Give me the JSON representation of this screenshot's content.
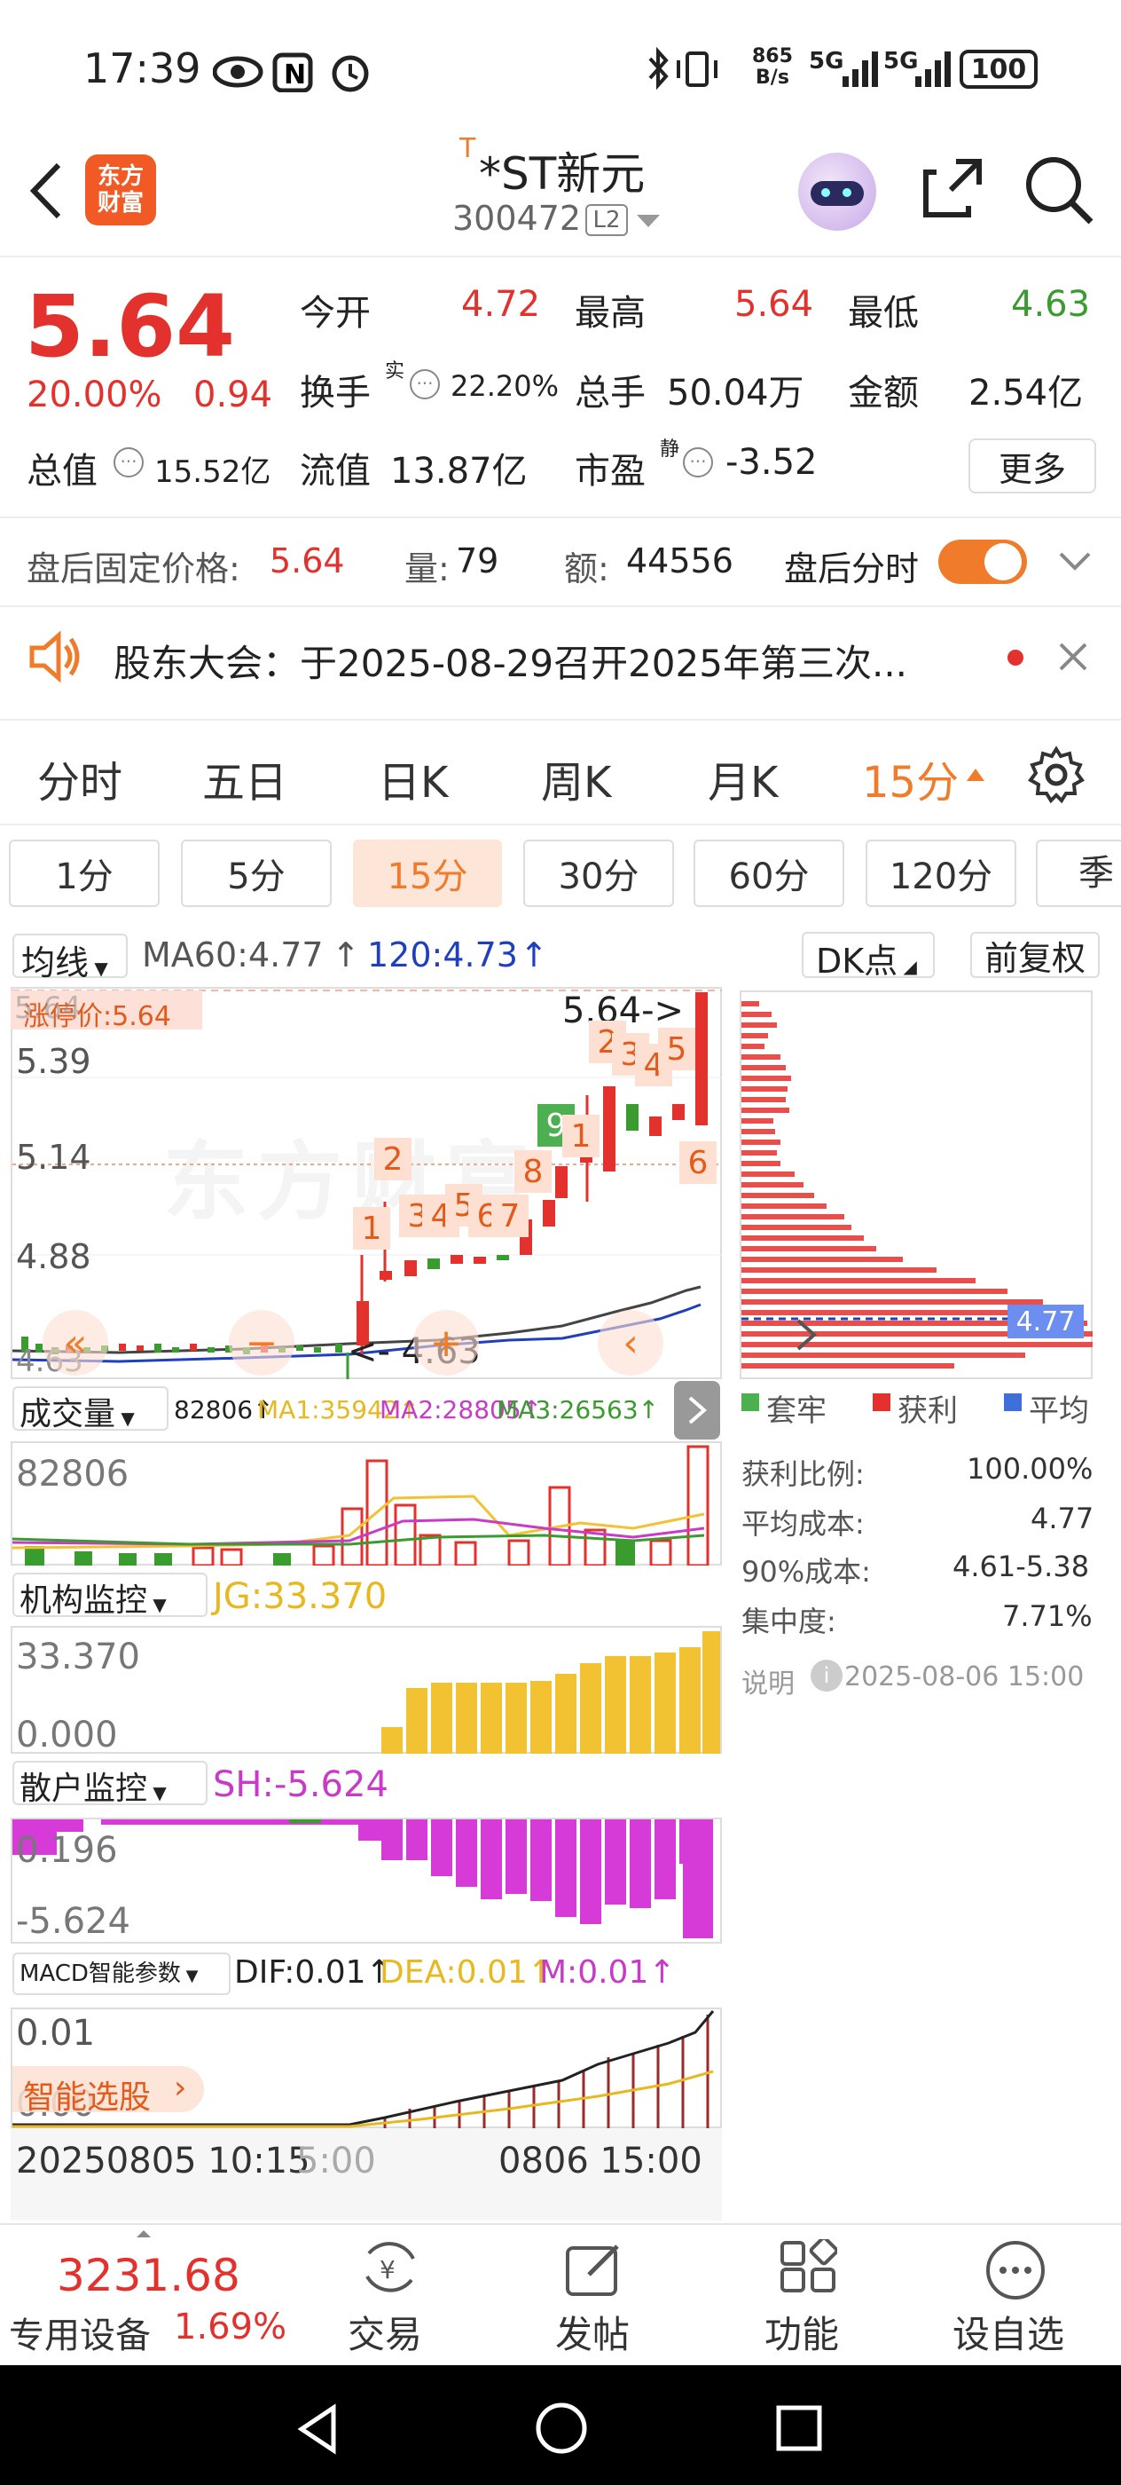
{
  "status_bar": {
    "time": "17:39",
    "net_speed_top": "865",
    "net_speed_bottom": "B/s",
    "sig1": "5G",
    "sig2": "5G",
    "battery": "100"
  },
  "header": {
    "logo_top": "东方",
    "logo_bottom": "财富",
    "prefix": "T",
    "name": "*ST新元",
    "code": "300472",
    "level": "L2"
  },
  "quote": {
    "price": "5.64",
    "change_pct": "20.00%",
    "change": "0.94",
    "open_label": "今开",
    "open": "4.72",
    "high_label": "最高",
    "high": "5.64",
    "low_label": "最低",
    "low": "4.63",
    "turnover_label": "换手",
    "turnover_sup": "实",
    "turnover": "22.20%",
    "volume_label": "总手",
    "volume": "50.04万",
    "amount_label": "金额",
    "amount": "2.54亿",
    "mcap_label": "总值",
    "mcap": "15.52亿",
    "float_label": "流值",
    "float": "13.87亿",
    "pe_label": "市盈",
    "pe_sup": "静",
    "pe": "-3.52",
    "more_button": "更多"
  },
  "after_hours": {
    "price_label": "盘后固定价格:",
    "price": "5.64",
    "vol_label": "量:",
    "vol": "79",
    "amt_label": "额:",
    "amt": "44556",
    "toggle_label": "盘后分时"
  },
  "notice": {
    "text": "股东大会：于2025-08-29召开2025年第三次..."
  },
  "period_tabs": [
    "分时",
    "五日",
    "日K",
    "周K",
    "月K",
    "15分"
  ],
  "minute_buttons": [
    "1分",
    "5分",
    "15分",
    "30分",
    "60分",
    "120分",
    "季"
  ],
  "kline": {
    "ma_selector": "均线",
    "ma60": "MA60:4.77",
    "ma120": "120:4.73",
    "dk_button": "DK点",
    "fq_button": "前复权",
    "limit_label": "涨停价:5.64",
    "y_top": "5.64",
    "y1": "5.39",
    "y2": "5.14",
    "y3": "4.88",
    "y_bottom": "4.63",
    "high_mark": "5.64->",
    "low_mark": "<- 4.63",
    "watermark": "东方财富",
    "seq_tags": [
      "1",
      "2",
      "3",
      "4",
      "5",
      "6",
      "7",
      "8",
      "9",
      "1",
      "2",
      "3",
      "4",
      "5",
      "6"
    ]
  },
  "chip": {
    "cost_tag": "4.77",
    "legend": [
      "套牢",
      "获利",
      "平均"
    ],
    "rows": [
      {
        "label": "获利比例:",
        "value": "100.00%"
      },
      {
        "label": "平均成本:",
        "value": "4.77"
      },
      {
        "label": "90%成本:",
        "value": "4.61-5.38"
      },
      {
        "label": "集中度:",
        "value": "7.71%"
      }
    ],
    "note_label": "说明",
    "note_date": "2025-08-06 15:00"
  },
  "volume": {
    "selector": "成交量",
    "vol": "82806↑",
    "ma1": "MA1:35942↑",
    "ma2": "MA2:28805↑",
    "ma3": "MA3:26563↑",
    "axis": "82806"
  },
  "jg": {
    "selector": "机构监控",
    "value": "JG:33.370",
    "axis_top": "33.370",
    "axis_bottom": "0.000"
  },
  "sh": {
    "selector": "散户监控",
    "value": "SH:-5.624",
    "axis_top": "0.196",
    "axis_bottom": "-5.624"
  },
  "macd": {
    "selector": "MACD智能参数",
    "dif": "DIF:0.01↑",
    "dea": "DEA:0.01↑",
    "m": "M:0.01↑",
    "axis_top": "0.01",
    "axis_bottom": "0.00",
    "smart_button": "智能选股",
    "x_left": "20250805 10:15",
    "x_mid": "5:00",
    "x_right": "0806 15:00"
  },
  "bottom_nav": {
    "index_value": "3231.68",
    "sector": "专用设备",
    "sector_pct": "1.69%",
    "trade": "交易",
    "post": "发帖",
    "func": "功能",
    "fav": "设自选"
  },
  "colors": {
    "red": "#e3312d",
    "green": "#3a9b2f",
    "orange": "#f07c2b",
    "gold": "#f2c233",
    "magenta": "#d63bd8"
  }
}
